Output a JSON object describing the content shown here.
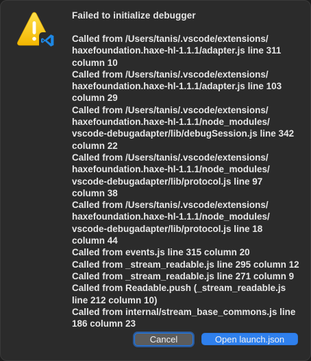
{
  "dialog": {
    "title": "Failed to initialize debugger",
    "message_lines": [
      "Called from /Users/tanis/.vscode/extensions/",
      "haxefoundation.haxe-hl-1.1.1/adapter.js line 311",
      "column 10",
      "Called from /Users/tanis/.vscode/extensions/",
      "haxefoundation.haxe-hl-1.1.1/adapter.js line 103",
      "column 29",
      "Called from /Users/tanis/.vscode/extensions/",
      "haxefoundation.haxe-hl-1.1.1/node_modules/",
      "vscode-debugadapter/lib/debugSession.js line 342",
      "column 22",
      "Called from /Users/tanis/.vscode/extensions/",
      "haxefoundation.haxe-hl-1.1.1/node_modules/",
      "vscode-debugadapter/lib/protocol.js line 97",
      "column 38",
      "Called from /Users/tanis/.vscode/extensions/",
      "haxefoundation.haxe-hl-1.1.1/node_modules/",
      "vscode-debugadapter/lib/protocol.js line 18",
      "column 44",
      "Called from events.js line 315 column 20",
      "Called from _stream_readable.js line 295 column 12",
      "Called from _stream_readable.js line 271 column 9",
      "Called from Readable.push (_stream_readable.js",
      "line 212 column 10)",
      "Called from internal/stream_base_commons.js line",
      "186 column 23"
    ],
    "icon": "warning-with-vscode-badge-icon",
    "buttons": {
      "cancel_label": "Cancel",
      "open_label": "Open launch.json"
    }
  },
  "colors": {
    "dialog_background": "#2b2b2b",
    "text": "#e6e6e6",
    "warning_yellow": "#f5c400",
    "vscode_blue": "#1e88e5",
    "primary_button": "#2f80ed",
    "secondary_button": "#5c5c5c"
  }
}
